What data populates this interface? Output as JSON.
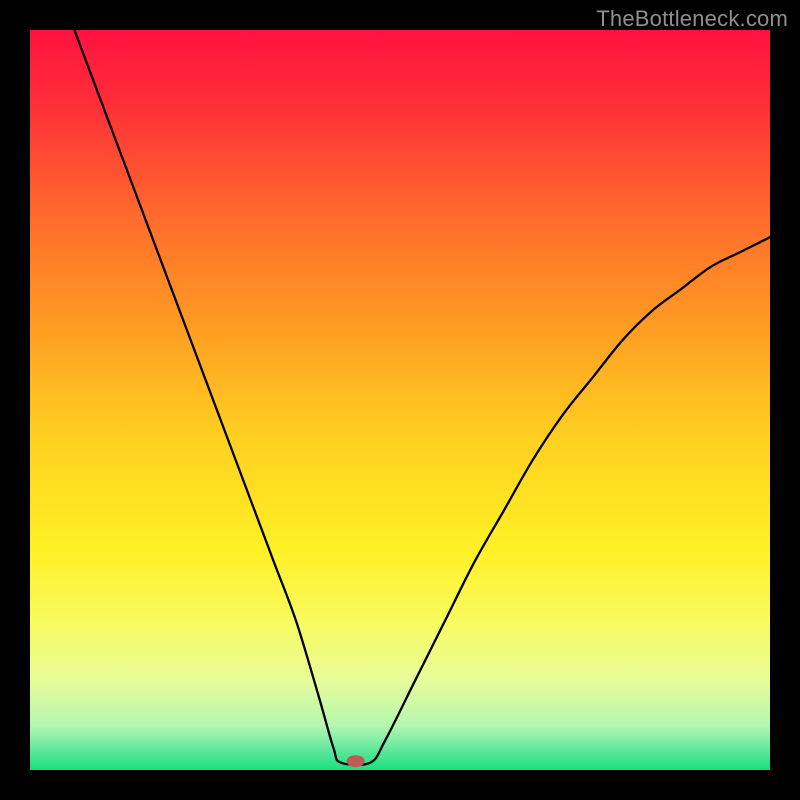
{
  "watermark": "TheBottleneck.com",
  "chart_data": {
    "type": "line",
    "title": "",
    "xlabel": "",
    "ylabel": "",
    "xlim": [
      0,
      100
    ],
    "ylim": [
      0,
      100
    ],
    "grid": false,
    "background_gradient_stops": [
      {
        "offset": 0.0,
        "color": "#ff1240"
      },
      {
        "offset": 0.1,
        "color": "#ff2e38"
      },
      {
        "offset": 0.25,
        "color": "#ff6a2c"
      },
      {
        "offset": 0.4,
        "color": "#ff9c22"
      },
      {
        "offset": 0.55,
        "color": "#ffd020"
      },
      {
        "offset": 0.7,
        "color": "#fff024"
      },
      {
        "offset": 0.8,
        "color": "#f8fb60"
      },
      {
        "offset": 0.88,
        "color": "#e8fb9a"
      },
      {
        "offset": 0.94,
        "color": "#b4f7b0"
      },
      {
        "offset": 0.975,
        "color": "#5ae69a"
      },
      {
        "offset": 1.0,
        "color": "#18e07e"
      }
    ],
    "series": [
      {
        "name": "bottleneck-curve",
        "note": "V-shaped curve; y ≈ 100 at x≈6, falls to ~0 near x≈42–46 (flat trough), then rises to ~72 at x=100",
        "x": [
          6,
          9,
          12,
          15,
          18,
          21,
          24,
          27,
          30,
          33,
          36,
          39,
          41,
          42,
          46,
          48,
          52,
          56,
          60,
          64,
          68,
          72,
          76,
          80,
          84,
          88,
          92,
          96,
          100
        ],
        "values": [
          100,
          92,
          84,
          76,
          68,
          60,
          52,
          44,
          36,
          28,
          20,
          10,
          3,
          1,
          1,
          4,
          12,
          20,
          28,
          35,
          42,
          48,
          53,
          58,
          62,
          65,
          68,
          70,
          72
        ]
      }
    ],
    "marker": {
      "name": "min-point",
      "x": 44,
      "y": 1.2,
      "color": "#c05a56",
      "rx": 9,
      "ry": 6
    }
  }
}
